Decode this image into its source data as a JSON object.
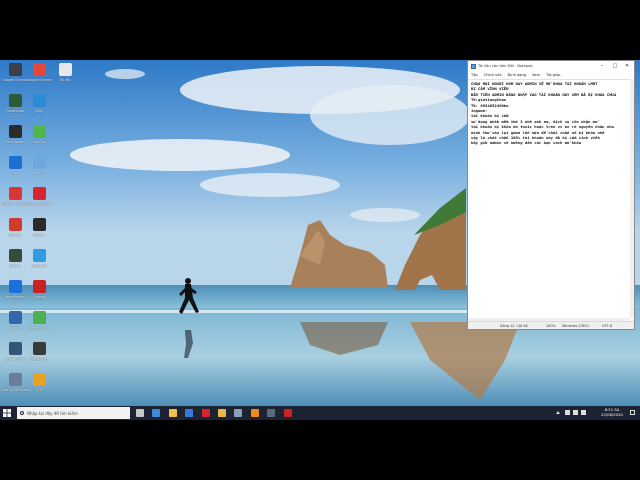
{
  "desktop": {
    "icons": [
      {
        "label": "Google Chrome",
        "icon": "app-icon-dark",
        "color": "#3a3f4a"
      },
      {
        "label": "Google Chrome",
        "icon": "chrome-icon",
        "color": "#e5473d"
      },
      {
        "label": "Tài liệu",
        "icon": "document-icon",
        "color": "#e8e8e8"
      },
      {
        "label": "GameLoop",
        "icon": "app-icon-dark",
        "color": "#2d5a3a"
      },
      {
        "label": "Zalo",
        "icon": "zalo-icon",
        "color": "#2d8bd6"
      },
      {
        "label": "Ultra Viewer",
        "icon": "app-icon-dark",
        "color": "#2b2b2b"
      },
      {
        "label": "Coc Coc",
        "icon": "green-app-icon",
        "color": "#4fb648"
      },
      {
        "label": "Zalo",
        "icon": "zalo-icon",
        "color": "#1d6fd1"
      },
      {
        "label": "This PC",
        "icon": "computer-icon",
        "color": "#6fa8dc"
      },
      {
        "label": "Google Chrome",
        "icon": "red-app-icon",
        "color": "#d93636"
      },
      {
        "label": "Opera Browser",
        "icon": "opera-icon",
        "color": "#d6252f"
      },
      {
        "label": "Garena",
        "icon": "garena-icon",
        "color": "#d33a2e"
      },
      {
        "label": "Roblox",
        "icon": "app-icon-dark",
        "color": "#2a2a2a"
      },
      {
        "label": "Steam",
        "icon": "app-icon-dark",
        "color": "#3a4a3a"
      },
      {
        "label": "Telegram",
        "icon": "telegram-icon",
        "color": "#2f9de0"
      },
      {
        "label": "TeamViewer",
        "icon": "teamviewer-icon",
        "color": "#1b6fd8"
      },
      {
        "label": "Garena",
        "icon": "red-app-icon",
        "color": "#c82222"
      },
      {
        "label": "Proxifier",
        "icon": "app-icon",
        "color": "#3366aa"
      },
      {
        "label": "Recycle Bin",
        "icon": "recycle-icon",
        "color": "#4caf50"
      },
      {
        "label": "Control Panel",
        "icon": "app-icon",
        "color": "#335577"
      },
      {
        "label": "Notepad++",
        "icon": "app-icon-dark",
        "color": "#3a3a3a"
      },
      {
        "label": "Quản lý Tài khoản",
        "icon": "app-icon",
        "color": "#6a7e99"
      },
      {
        "label": "VLC",
        "icon": "app-icon",
        "color": "#e9a21f"
      },
      {
        "label": "Dota",
        "icon": "app-icon-dark",
        "color": "#1d2130"
      },
      {
        "label": "Ghi chú",
        "icon": "app-icon",
        "color": "#5070a0"
      },
      {
        "label": "Kiểm tra",
        "icon": "vlc-icon",
        "color": "#f08c1a"
      }
    ]
  },
  "notepad": {
    "title": "Tài liệu văn bản Mới - Notepad",
    "menu": [
      "Tệp",
      "Chỉnh sửa",
      "Định dạng",
      "Xem",
      "Trợ giúp"
    ],
    "lines": [
      "CHÀO MỌI NGƯỜI HÔM NAY ADMIN SẼ MỞ KHÓA TÀI KHOẢN LMHT",
      "BỊ CẤM VĨNH VIỄN",
      "ĐẦU TIÊN ADMIN ĐĂNG NHẬP VÀO TÀI KHOẢN NÀY XEM ĐÃ BỊ KHÓA CHƯA",
      "TK:giatiangthao",
      "TK: 0934652490ba",
      "ingame:",
      "tài khoản bị cấm",
      "sử dụng phần mềm thứ 3 nhé anh em, dịch vụ còn nhận mở",
      "tài khoản bị khóa do toxic hoặc treo vv ko rõ nguyên nhân nha",
      "mình thử vào lại game lần nữa để chắc chắn nó bị khóa nhé",
      "vậy là chắc chắn 100% tài khoản này đã bị cấm vĩnh viễn",
      "bây giờ admin sẽ hướng dẫn các bạn cách mở khóa"
    ],
    "status": {
      "position": "Dòng 12, Cột 48",
      "zoom": "100%",
      "line_ending": "Windows (CRLF)",
      "encoding": "UTF-8"
    }
  },
  "taskbar": {
    "search_placeholder": "Nhập tại đây để tìm kiếm",
    "time": "8:51 SA",
    "date": "22/06/2020",
    "apps": [
      {
        "icon": "task-view-icon",
        "color": "#c8c8c8"
      },
      {
        "icon": "edge-icon",
        "color": "#3b8ad9"
      },
      {
        "icon": "file-explorer-icon",
        "color": "#f2c14e"
      },
      {
        "icon": "store-icon",
        "color": "#3a7bd5"
      },
      {
        "icon": "opera-icon",
        "color": "#d6252f"
      },
      {
        "icon": "folder-icon",
        "color": "#e9b64a"
      },
      {
        "icon": "app-icon",
        "color": "#8aa0b8"
      },
      {
        "icon": "vlc-icon",
        "color": "#f08c1a"
      },
      {
        "icon": "app-icon",
        "color": "#5a6a7a"
      },
      {
        "icon": "recorder-icon",
        "color": "#cc2222"
      }
    ]
  }
}
